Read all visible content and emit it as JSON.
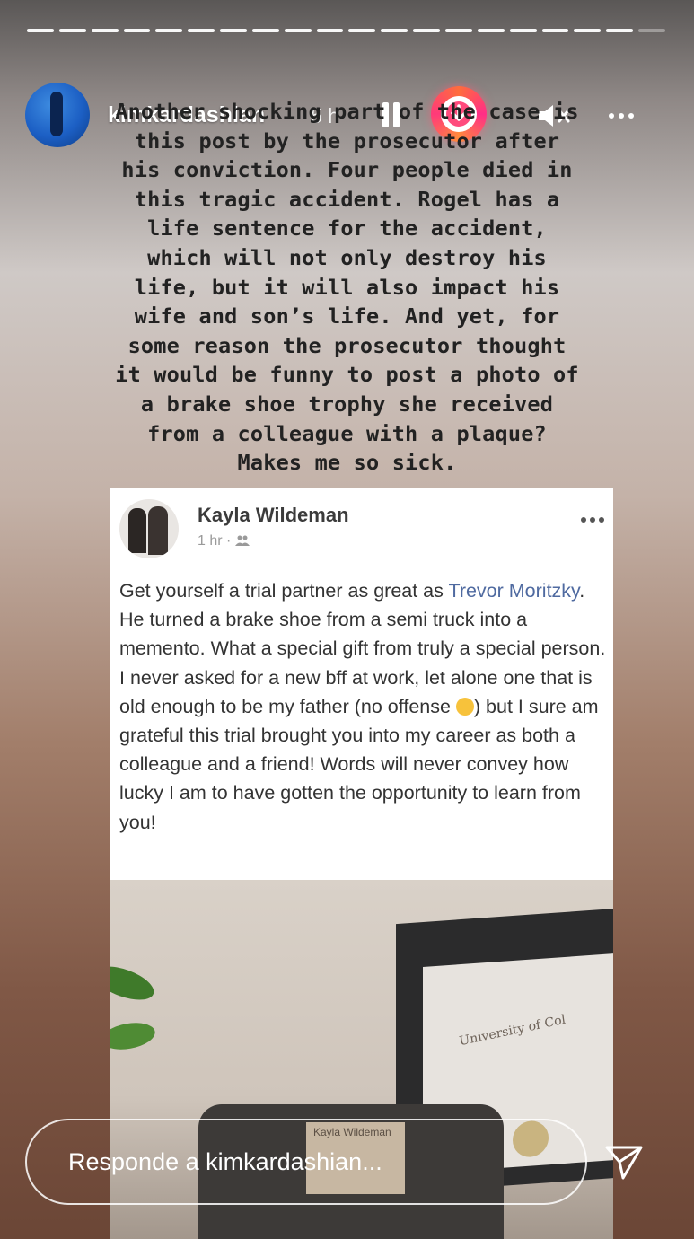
{
  "story": {
    "username": "kimkardashian",
    "time": "5 h",
    "progress": {
      "segments": 20,
      "current": 19
    },
    "icons": {
      "pause": "pause-icon",
      "download": "download-icon",
      "mute": "mute-icon",
      "more": "more-options-icon"
    }
  },
  "caption": {
    "lines": [
      "Another shocking part of the case is",
      "this post by the prosecutor after",
      "his conviction. Four people died in",
      "this tragic accident. Rogel has a",
      "life sentence for the accident,",
      "which will not only destroy his",
      "life, but it will also impact his",
      "wife and son’s life. And yet, for",
      "some reason the prosecutor thought",
      "it would be funny to post a photo of",
      "a brake shoe trophy she received",
      "from a colleague with a plaque?",
      "Makes me so sick."
    ]
  },
  "post": {
    "author": "Kayla Wildeman",
    "meta": "1 hr · ",
    "body_before_link": "Get yourself a trial partner as great as ",
    "link": "Trevor Moritzky",
    "body_middle": ". He turned a brake shoe from a semi truck into a memento. What a special gift from truly a special person. I never asked for a new bff at work, let alone one that is old enough to be my father (no offense ",
    "body_after_emoji": ") but I sure am grateful this trial brought you into my career as both a colleague and a friend! Words will never convey how lucky I am to have gotten the opportunity to learn from you!",
    "photo": {
      "plaque_text": "Kayla Wildeman",
      "diploma_text": "University of Col"
    }
  },
  "reply": {
    "placeholder": "Responde a kimkardashian..."
  },
  "colors": {
    "caption_text": "#222222",
    "link": "#4f6aa0",
    "download_ring": "#ff2e87"
  }
}
